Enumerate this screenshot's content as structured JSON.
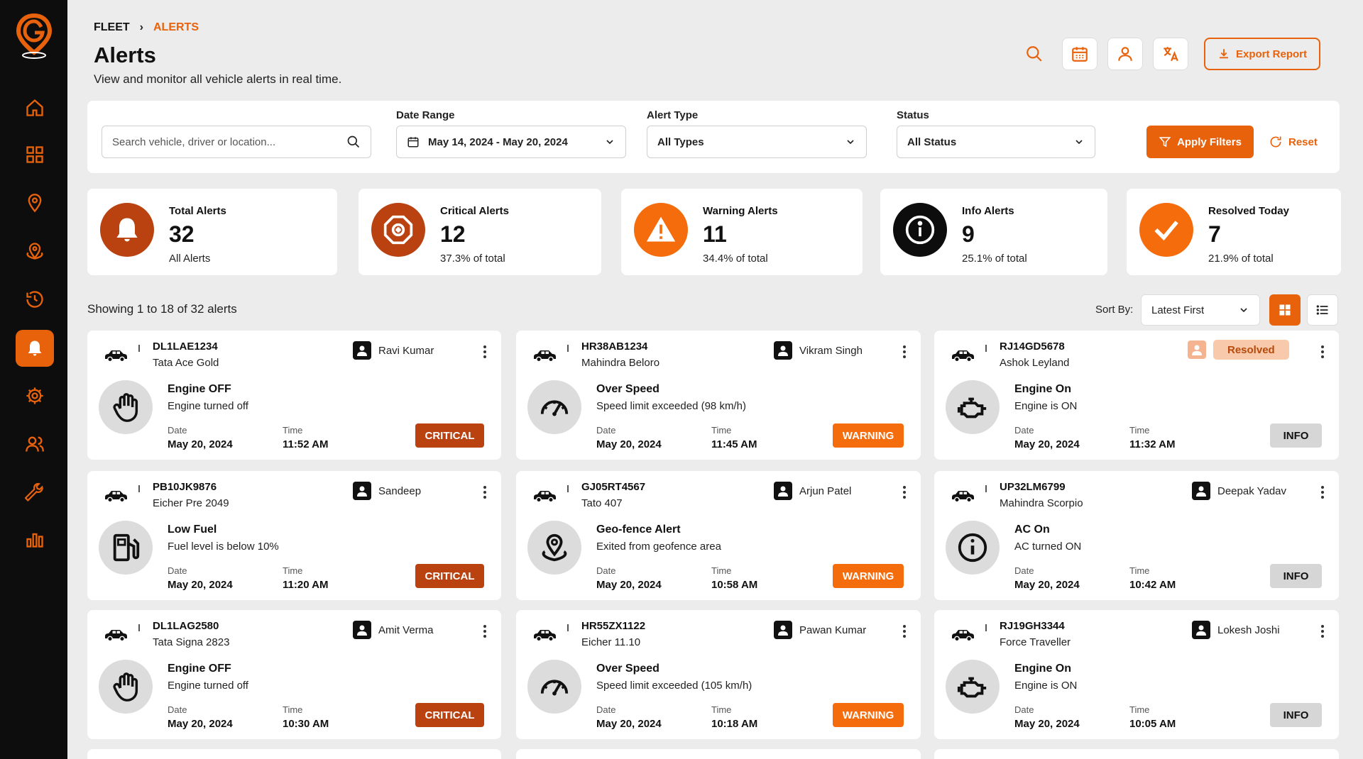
{
  "breadcrumb": {
    "root": "FLEET",
    "current": "ALERTS"
  },
  "page": {
    "title": "Alerts",
    "subtitle": "View and monitor all vehicle alerts in real time."
  },
  "actions": {
    "export_label": "Export Report"
  },
  "colors": {
    "accent": "#e8620c",
    "critical": "#b94210",
    "warning": "#f46c0c",
    "info": "#d6d6d6",
    "sidebar": "#0d0d0d"
  },
  "sidebar": {
    "items": [
      {
        "icon": "home-icon"
      },
      {
        "icon": "dashboard-icon"
      },
      {
        "icon": "location-pin-icon"
      },
      {
        "icon": "geofence-icon"
      },
      {
        "icon": "history-icon"
      },
      {
        "icon": "bell-icon",
        "active": true
      },
      {
        "icon": "gear-icon"
      },
      {
        "icon": "users-icon"
      },
      {
        "icon": "wrench-icon"
      },
      {
        "icon": "bar-chart-icon"
      }
    ]
  },
  "filters": {
    "search_placeholder": "Search vehicle, driver or location...",
    "date_range_label": "Date Range",
    "date_range_value": "May 14, 2024 - May 20, 2024",
    "alert_type_label": "Alert Type",
    "alert_type_value": "All Types",
    "status_label": "Status",
    "status_value": "All Status",
    "apply_label": "Apply Filters",
    "reset_label": "Reset"
  },
  "stats": [
    {
      "title": "Total Alerts",
      "value": "32",
      "sub": "All Alerts"
    },
    {
      "title": "Critical Alerts",
      "value": "12",
      "sub": "37.3% of total"
    },
    {
      "title": "Warning Alerts",
      "value": "11",
      "sub": "34.4% of total"
    },
    {
      "title": "Info Alerts",
      "value": "9",
      "sub": "25.1% of total"
    },
    {
      "title": "Resolved Today",
      "value": "7",
      "sub": "21.9% of total"
    }
  ],
  "list": {
    "showing": "Showing 1 to 18 of 32 alerts",
    "sort_label": "Sort By:",
    "sort_value": "Latest First",
    "date_label": "Date",
    "time_label": "Time"
  },
  "alerts": [
    {
      "plate": "DL1LAE1234",
      "model": "Tata Ace Gold",
      "driver": "Ravi Kumar",
      "title": "Engine OFF",
      "desc": "Engine turned off",
      "date": "May 20, 2024",
      "time": "11:52 AM",
      "severity": "CRITICAL",
      "icon": "hand-stop-icon"
    },
    {
      "plate": "HR38AB1234",
      "model": "Mahindra Beloro",
      "driver": "Vikram Singh",
      "title": "Over Speed",
      "desc": "Speed limit exceeded (98 km/h)",
      "date": "May 20, 2024",
      "time": "11:45 AM",
      "severity": "WARNING",
      "icon": "speedometer-icon"
    },
    {
      "plate": "RJ14GD5678",
      "model": "Ashok Leyland",
      "driver": "Resolved",
      "title": "Engine On",
      "desc": "Engine is ON",
      "date": "May 20, 2024",
      "time": "11:32 AM",
      "severity": "INFO",
      "icon": "engine-icon"
    },
    {
      "plate": "PB10JK9876",
      "model": "Eicher Pre 2049",
      "driver": "Sandeep",
      "title": "Low Fuel",
      "desc": "Fuel level is below 10%",
      "date": "May 20, 2024",
      "time": "11:20 AM",
      "severity": "CRITICAL",
      "icon": "fuel-icon"
    },
    {
      "plate": "GJ05RT4567",
      "model": "Tato 407",
      "driver": "Arjun Patel",
      "title": "Geo-fence Alert",
      "desc": "Exited from geofence area",
      "date": "May 20, 2024",
      "time": "10:58 AM",
      "severity": "WARNING",
      "icon": "geofence-pin-icon"
    },
    {
      "plate": "UP32LM6799",
      "model": "Mahindra Scorpio",
      "driver": "Deepak Yadav",
      "title": "AC On",
      "desc": "AC turned ON",
      "date": "May 20, 2024",
      "time": "10:42 AM",
      "severity": "INFO",
      "icon": "info-icon"
    },
    {
      "plate": "DL1LAG2580",
      "model": "Tata Signa 2823",
      "driver": "Amit Verma",
      "title": "Engine OFF",
      "desc": "Engine turned off",
      "date": "May 20, 2024",
      "time": "10:30 AM",
      "severity": "CRITICAL",
      "icon": "hand-stop-icon"
    },
    {
      "plate": "HR55ZX1122",
      "model": "Eicher 11.10",
      "driver": "Pawan Kumar",
      "title": "Over Speed",
      "desc": "Speed limit exceeded (105 km/h)",
      "date": "May 20, 2024",
      "time": "10:18 AM",
      "severity": "WARNING",
      "icon": "speedometer-icon"
    },
    {
      "plate": "RJ19GH3344",
      "model": "Force Traveller",
      "driver": "Lokesh Joshi",
      "title": "Engine On",
      "desc": "Engine is ON",
      "date": "May 20, 2024",
      "time": "10:05 AM",
      "severity": "INFO",
      "icon": "engine-icon"
    }
  ]
}
